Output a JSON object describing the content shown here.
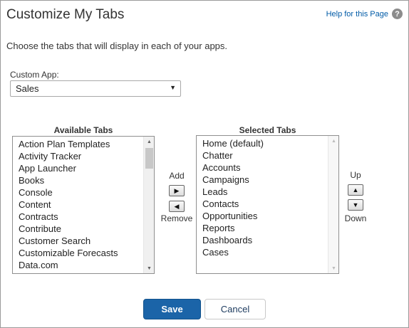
{
  "header": {
    "title": "Customize My Tabs",
    "help_link": "Help for this Page",
    "help_icon": "?"
  },
  "intro": "Choose the tabs that will display in each of your apps.",
  "custom_app": {
    "label": "Custom App:",
    "selected": "Sales",
    "arrow": "▼"
  },
  "available": {
    "header": "Available Tabs",
    "items": [
      "Action Plan Templates",
      "Activity Tracker",
      "App Launcher",
      "Books",
      "Console",
      "Content",
      "Contracts",
      "Contribute",
      "Customer Search",
      "Customizable Forecasts",
      "Data.com"
    ]
  },
  "selected": {
    "header": "Selected Tabs",
    "items": [
      "Home (default)",
      "Chatter",
      "Accounts",
      "Campaigns",
      "Leads",
      "Contacts",
      "Opportunities",
      "Reports",
      "Dashboards",
      "Cases"
    ]
  },
  "controls": {
    "add_label": "Add",
    "remove_label": "Remove",
    "up_label": "Up",
    "down_label": "Down",
    "add_glyph": "▶",
    "remove_glyph": "◀",
    "up_glyph": "▲",
    "down_glyph": "▼"
  },
  "scroll_glyphs": {
    "up": "▲",
    "down": "▼"
  },
  "buttons": {
    "save": "Save",
    "cancel": "Cancel"
  },
  "colors": {
    "save_bg": "#1b64a8",
    "link": "#015ba7"
  }
}
